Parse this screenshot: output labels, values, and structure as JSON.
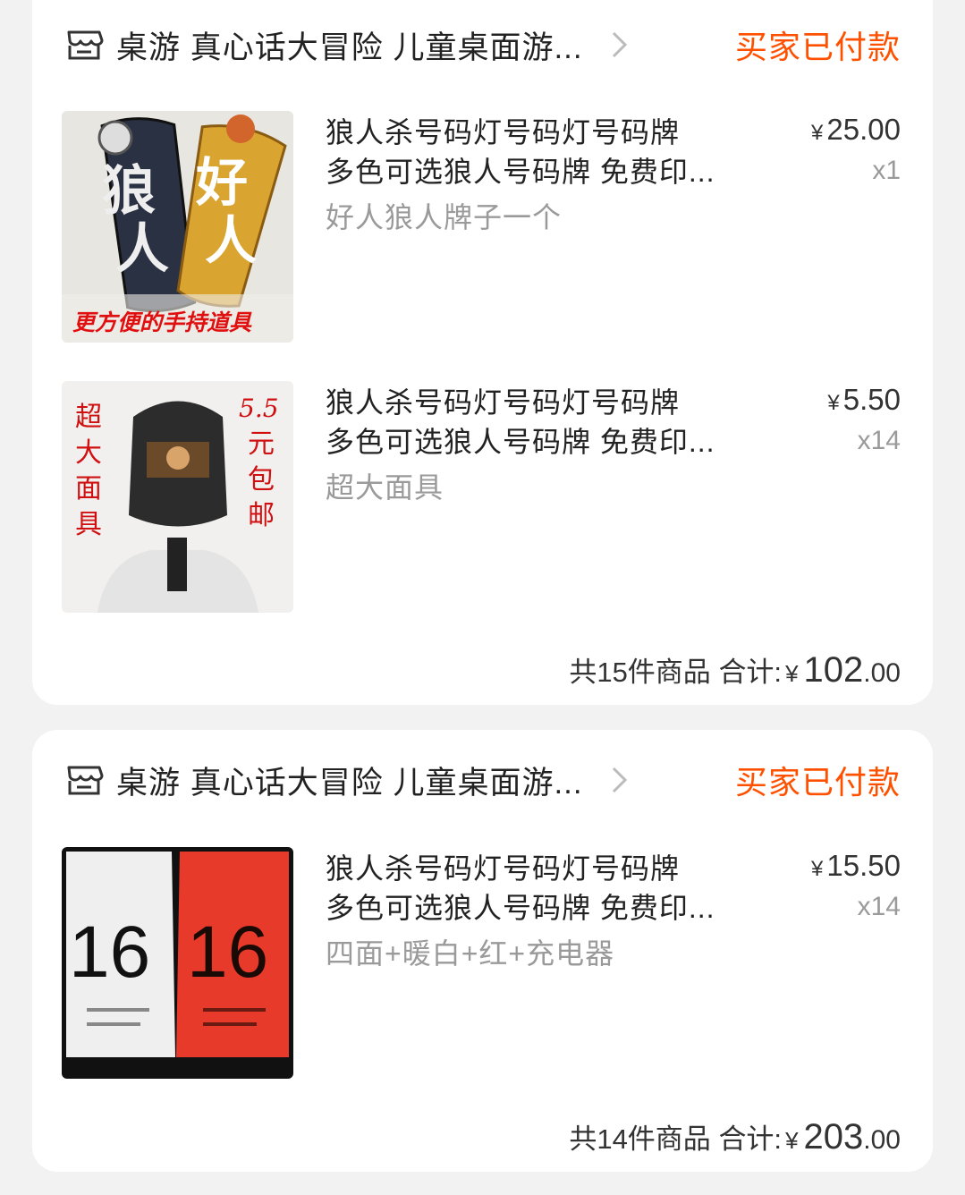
{
  "orders": [
    {
      "store_name": "桌游 真心话大冒险 儿童桌面游...",
      "status": "买家已付款",
      "items": [
        {
          "title_line1": "狼人杀号码灯号码灯号码牌",
          "title_line2": "多色可选狼人号码牌 免费印...",
          "spec": "好人狼人牌子一个",
          "currency": "¥",
          "price": "25.00",
          "qty": "x1",
          "image": {
            "left_char1": "狼",
            "left_char2": "人",
            "right_char1": "好",
            "right_char2": "人",
            "caption": "更方便的手持道具"
          }
        },
        {
          "title_line1": "狼人杀号码灯号码灯号码牌",
          "title_line2": "多色可选狼人号码牌 免费印...",
          "spec": "超大面具",
          "currency": "¥",
          "price": "5.50",
          "qty": "x14",
          "image": {
            "left_text": [
              "超",
              "大",
              "面",
              "具"
            ],
            "right_top": "5.5",
            "right_text": [
              "元",
              "包",
              "邮"
            ]
          }
        }
      ],
      "total": {
        "count_text": "共15件商品",
        "sum_label": "合计:",
        "currency": "¥",
        "amount_int": "102",
        "amount_dec": ".00"
      }
    },
    {
      "store_name": "桌游 真心话大冒险 儿童桌面游...",
      "status": "买家已付款",
      "items": [
        {
          "title_line1": "狼人杀号码灯号码灯号码牌",
          "title_line2": "多色可选狼人号码牌 免费印...",
          "spec": "四面+暖白+红+充电器",
          "currency": "¥",
          "price": "15.50",
          "qty": "x14",
          "image": {
            "left_number": "16",
            "right_number": "16"
          }
        }
      ],
      "total": {
        "count_text": "共14件商品",
        "sum_label": "合计:",
        "currency": "¥",
        "amount_int": "203",
        "amount_dec": ".00"
      }
    }
  ],
  "colors": {
    "status": "#ff5000",
    "background": "#f2f2f2",
    "card": "#ffffff"
  }
}
